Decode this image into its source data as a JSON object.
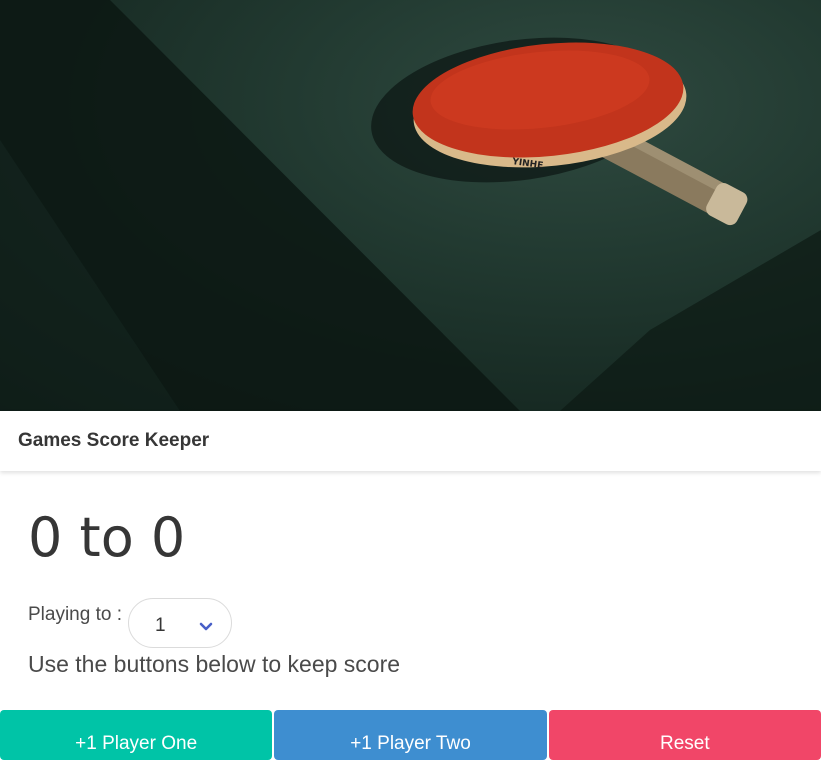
{
  "app": {
    "title": "Games Score Keeper"
  },
  "score": {
    "display": "0 to 0"
  },
  "playing_to": {
    "label": "Playing to :",
    "selected": "1"
  },
  "hint": "Use the buttons below to keep score",
  "buttons": {
    "player_one": "+1 Player One",
    "player_two": "+1 Player Two",
    "reset": "Reset"
  },
  "colors": {
    "player_one": "#00c4a7",
    "player_two": "#3e8ed0",
    "reset": "#f14668",
    "chevron": "#485fc7"
  },
  "hero_image": {
    "paddle_text": "YINHE"
  }
}
